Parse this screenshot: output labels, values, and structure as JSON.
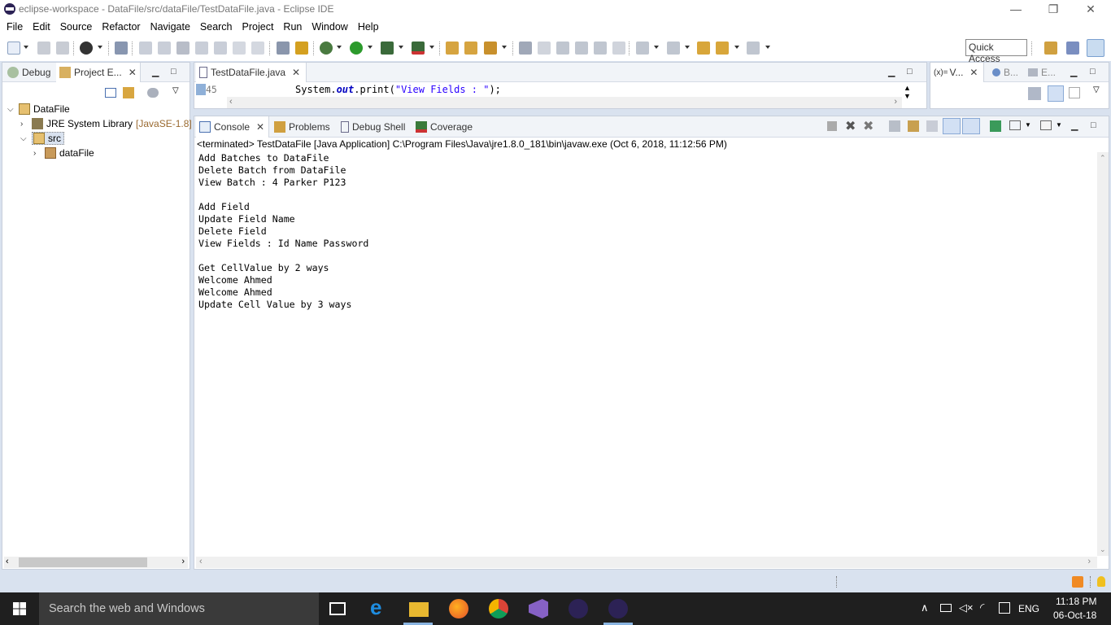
{
  "window": {
    "title": "eclipse-workspace - DataFile/src/dataFile/TestDataFile.java - Eclipse IDE",
    "minimize_glyph": "—",
    "maximize_glyph": "❐",
    "close_glyph": "✕"
  },
  "menu": [
    "File",
    "Edit",
    "Source",
    "Refactor",
    "Navigate",
    "Search",
    "Project",
    "Run",
    "Window",
    "Help"
  ],
  "toolbar": {
    "quick_access_label": "Quick Access"
  },
  "left_panel": {
    "tabs": [
      {
        "label": "Debug",
        "icon": "debug-icon"
      },
      {
        "label": "Project E...",
        "icon": "project-explorer-icon"
      }
    ],
    "tree": [
      {
        "label": "DataFile",
        "icon": "project-folder-icon",
        "expanded": true
      },
      {
        "label": "JRE System Library",
        "suffix": "[JavaSE-1.8]",
        "icon": "library-icon",
        "expanded": false
      },
      {
        "label": "src",
        "icon": "source-folder-icon",
        "expanded": true
      },
      {
        "label": "dataFile",
        "icon": "package-icon",
        "expanded": false
      }
    ]
  },
  "editor": {
    "tab_label": "TestDataFile.java",
    "line_number": "45",
    "code": {
      "prefix": "System.",
      "field": "out",
      "method": ".print(",
      "string": "\"View Fields : \"",
      "suffix": ");"
    }
  },
  "right_panel": {
    "tabs": [
      {
        "label": "V...",
        "icon": "variables-icon"
      },
      {
        "label": "B...",
        "icon": "breakpoints-icon"
      },
      {
        "label": "E...",
        "icon": "expressions-icon"
      }
    ],
    "variables_prefix": "(x)="
  },
  "console": {
    "tabs": [
      {
        "label": "Console",
        "icon": "console-icon"
      },
      {
        "label": "Problems",
        "icon": "problems-icon"
      },
      {
        "label": "Debug Shell",
        "icon": "debug-shell-icon"
      },
      {
        "label": "Coverage",
        "icon": "coverage-icon"
      }
    ],
    "status_line": "<terminated> TestDataFile [Java Application] C:\\Program Files\\Java\\jre1.8.0_181\\bin\\javaw.exe (Oct 6, 2018, 11:12:56 PM)",
    "output": [
      "Add Batches to DataFile",
      "Delete Batch from DataFile",
      "View Batch : 4 Parker P123",
      "",
      "Add Field",
      "Update Field Name",
      "Delete Field",
      "View Fields : Id Name Password",
      "",
      "Get CellValue by 2 ways",
      "Welcome Ahmed",
      "Welcome Ahmed",
      "Update Cell Value by 3 ways"
    ]
  },
  "taskbar": {
    "search_placeholder": "Search the web and Windows",
    "apps": [
      "task-view-icon",
      "edge-icon",
      "file-explorer-icon",
      "firefox-icon",
      "chrome-icon",
      "visual-studio-icon",
      "eclipse-icon",
      "eclipse-icon"
    ],
    "language": "ENG",
    "time": "11:18 PM",
    "date": "06-Oct-18"
  },
  "colors": {
    "workbench_bg": "#d9e2ef",
    "keyword_field": "#0000c0",
    "string": "#2a00ff",
    "taskbar": "#1f1f1f"
  }
}
